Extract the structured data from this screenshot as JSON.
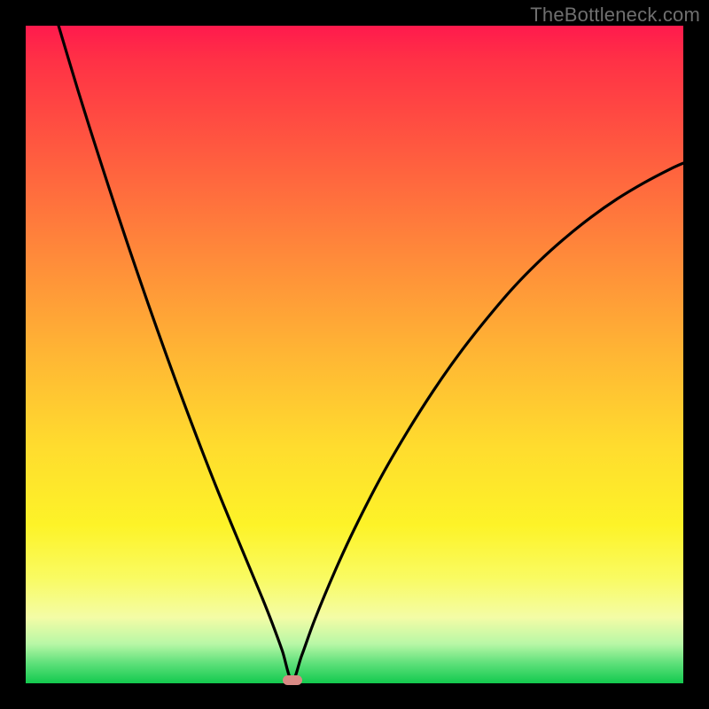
{
  "watermark": "TheBottleneck.com",
  "colors": {
    "frame_border": "#000000",
    "curve": "#000000",
    "marker": "#d98a85"
  },
  "chart_data": {
    "type": "line",
    "title": "",
    "xlabel": "",
    "ylabel": "",
    "xlim": [
      0,
      100
    ],
    "ylim": [
      0,
      100
    ],
    "grid": false,
    "legend": false,
    "minimum_x": 40.5,
    "series": [
      {
        "name": "bottleneck-curve",
        "x": [
          0,
          2,
          5,
          8,
          11,
          14,
          17,
          20,
          23,
          26,
          29,
          32,
          34,
          36,
          37.5,
          39,
          40.5,
          42,
          44,
          47,
          50,
          54,
          58,
          62,
          66,
          70,
          74,
          78,
          82,
          86,
          90,
          94,
          98,
          100
        ],
        "y": [
          118,
          110,
          100,
          90,
          80.5,
          71.3,
          62.4,
          53.8,
          45.5,
          37.5,
          29.8,
          22.5,
          17.7,
          12.9,
          9.1,
          5.0,
          0.5,
          4.3,
          9.8,
          17.0,
          23.5,
          31.3,
          38.2,
          44.5,
          50.2,
          55.3,
          60.0,
          64.1,
          67.7,
          70.9,
          73.7,
          76.1,
          78.2,
          79.1
        ]
      }
    ]
  }
}
